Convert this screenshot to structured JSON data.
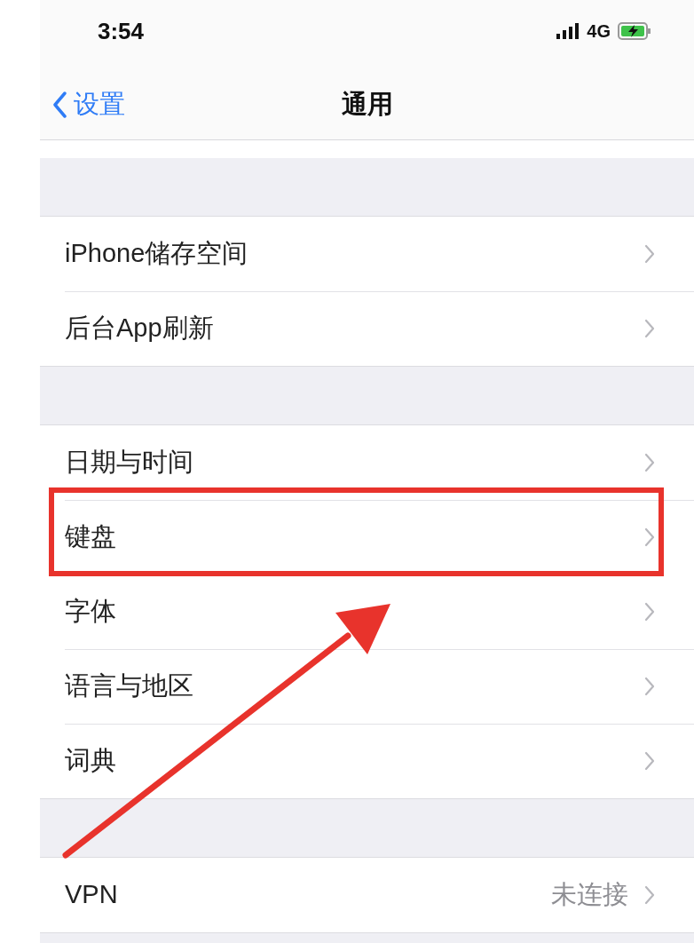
{
  "status_bar": {
    "time": "3:54",
    "network": "4G",
    "charging": true
  },
  "nav_bar": {
    "back_label": "设置",
    "title": "通用"
  },
  "sections": [
    {
      "rows": [
        {
          "label": "iPhone储存空间",
          "highlighted": false
        },
        {
          "label": "后台App刷新",
          "highlighted": false
        }
      ]
    },
    {
      "rows": [
        {
          "label": "日期与时间",
          "highlighted": false
        },
        {
          "label": "键盘",
          "highlighted": true
        },
        {
          "label": "字体",
          "highlighted": false
        },
        {
          "label": "语言与地区",
          "highlighted": false
        },
        {
          "label": "词典",
          "highlighted": false
        }
      ]
    },
    {
      "rows": [
        {
          "label": "VPN",
          "value": "未连接",
          "highlighted": false
        }
      ]
    }
  ]
}
